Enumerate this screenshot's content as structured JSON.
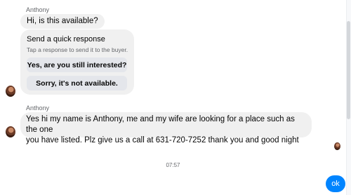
{
  "conversation": {
    "group1": {
      "sender": "Anthony",
      "message": "Hi, is this available?"
    },
    "quick_response": {
      "title": "Send a quick response",
      "subtitle": "Tap a response to send it to the buyer.",
      "options": [
        "Yes, are you still interested?",
        "Sorry, it's not available."
      ]
    },
    "group2": {
      "sender": "Anthony",
      "message_line1": "Yes hi my name is Anthony, me and my wife are looking for a place such as the one",
      "message_line2": "you have listed. Plz give us a call at 631-720-7252 thank you and good night"
    },
    "timestamp": "07:57",
    "sent_message": "ok"
  },
  "colors": {
    "incoming_bubble": "#f0f0f0",
    "outgoing_bubble": "#0084ff",
    "secondary_text": "#65676b"
  }
}
